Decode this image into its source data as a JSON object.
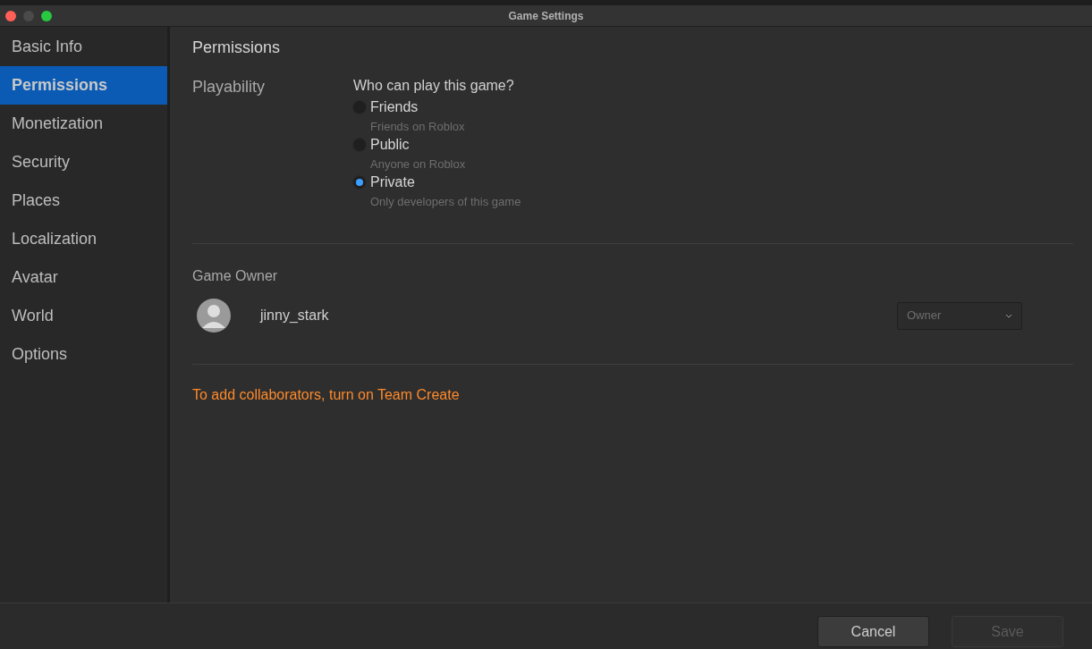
{
  "window": {
    "title": "Game Settings"
  },
  "sidebar": {
    "items": [
      {
        "label": "Basic Info",
        "selected": false
      },
      {
        "label": "Permissions",
        "selected": true
      },
      {
        "label": "Monetization",
        "selected": false
      },
      {
        "label": "Security",
        "selected": false
      },
      {
        "label": "Places",
        "selected": false
      },
      {
        "label": "Localization",
        "selected": false
      },
      {
        "label": "Avatar",
        "selected": false
      },
      {
        "label": "World",
        "selected": false
      },
      {
        "label": "Options",
        "selected": false
      }
    ]
  },
  "page": {
    "title": "Permissions",
    "playability": {
      "label": "Playability",
      "question": "Who can play this game?",
      "options": [
        {
          "label": "Friends",
          "description": "Friends on Roblox",
          "selected": false
        },
        {
          "label": "Public",
          "description": "Anyone on Roblox",
          "selected": false
        },
        {
          "label": "Private",
          "description": "Only developers of this game",
          "selected": true
        }
      ]
    },
    "owner": {
      "label": "Game Owner",
      "name": "jinny_stark",
      "role": {
        "value": "Owner",
        "disabled": true
      }
    },
    "notice": "To add collaborators, turn on Team Create"
  },
  "buttons": [
    {
      "label": "Cancel",
      "disabled": false
    },
    {
      "label": "Save",
      "disabled": true
    }
  ]
}
